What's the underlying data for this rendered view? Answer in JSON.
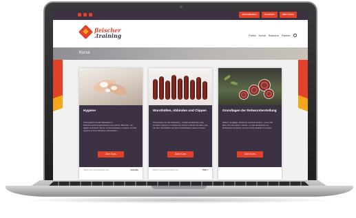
{
  "topbar": {
    "buttons": [
      "Administration",
      "Anmelden",
      "Mein Konto"
    ]
  },
  "logo": {
    "line1": "fleischer",
    "line2": ".training"
  },
  "nav": {
    "items": [
      "Portal",
      "Kurse",
      "Branche",
      "Partner"
    ],
    "search_icon": "search-icon"
  },
  "page": {
    "title": "Kurse"
  },
  "courses": [
    {
      "title": "Hygiene",
      "desc": "Trainingskurs für alle Mitarbeiter in Fleischverarbeitungsbetrieben und anderen Branchen, die täglich mit Fleisch, Wurst- und Fleischwaren umgehen und die Hygiene in ihren Betrieben sicherstellen.",
      "button": "Zum Kurs",
      "footer": "Dieser Kurs wird unterstützt von:",
      "footer_logo": "Hoeckle"
    },
    {
      "title": "Wursthüllen, Abbinden und Clippen",
      "desc": "Praxiswissen für alle Mitarbeiter – traditionell abbinden oder produktiv clippen? Im Verlauf des Kurses erfahren Sie alles, was Sie über Wursthüllen und deren Verschließen wissen müssen.",
      "button": "Zum Kurs",
      "footer": "Dieser Kurs wird unterstützt von:",
      "footer_logo": "POLY"
    },
    {
      "title": "Grundlagen der Rohwursterstellung",
      "desc": "Salami, Landjäger, Mettwurst und viele andere – lernen Sie alles, was Sie wissen müssen, um die Herstellung von Rohwürsten verstehen und eine hohe Qualität zu erzielen.",
      "button": "Zum Kurs",
      "footer": "",
      "footer_logo": ""
    }
  ],
  "colors": {
    "accent": "#e2412a",
    "accent_secondary": "#f3a51c",
    "dark_purple": "#3c3244"
  }
}
